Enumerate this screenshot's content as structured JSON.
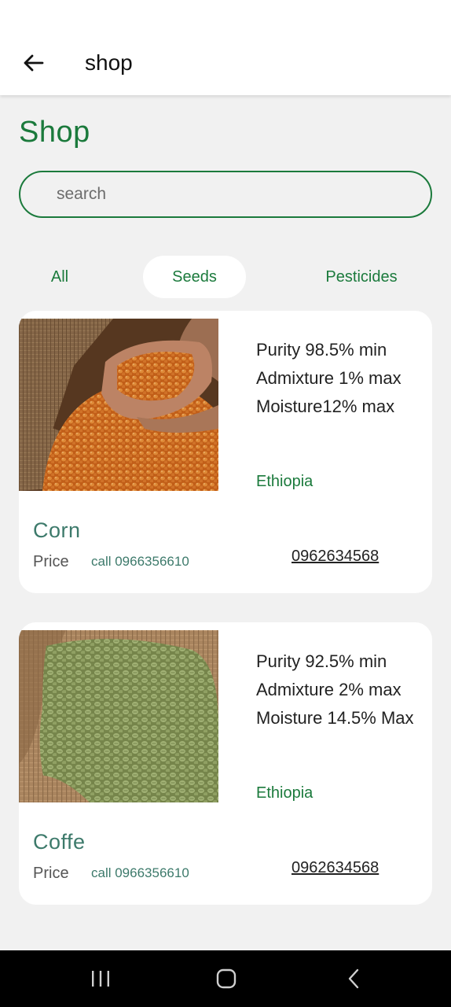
{
  "appbar": {
    "title": "shop",
    "back_icon": "arrow-left-icon"
  },
  "page": {
    "title": "Shop"
  },
  "search": {
    "placeholder": "search",
    "value": ""
  },
  "tabs": [
    {
      "label": "All",
      "selected": false
    },
    {
      "label": "Seeds",
      "selected": true
    },
    {
      "label": "Pesticides",
      "selected": false
    }
  ],
  "products": [
    {
      "name": "Corn",
      "image": "corn-kernels-photo",
      "specs": [
        "Purity 98.5% min",
        "Admixture  1% max",
        "Moisture12% max"
      ],
      "origin": "Ethiopia",
      "price_label": "Price",
      "call_text": "call 0966356610",
      "phone": "0962634568"
    },
    {
      "name": "Coffe",
      "image": "green-coffee-beans-photo",
      "specs": [
        "Purity 92.5% min",
        "Admixture 2% max",
        "Moisture 14.5% Max"
      ],
      "origin": "Ethiopia",
      "price_label": "Price",
      "call_text": "call 0966356610",
      "phone": "0962634568"
    }
  ],
  "system_nav": {
    "recent_icon": "recent-apps-icon",
    "home_icon": "home-icon",
    "back_icon": "back-chevron-icon"
  },
  "colors": {
    "brand_green": "#1b7a3c",
    "name_teal": "#3d7a6b",
    "background": "#f1f1f1"
  }
}
